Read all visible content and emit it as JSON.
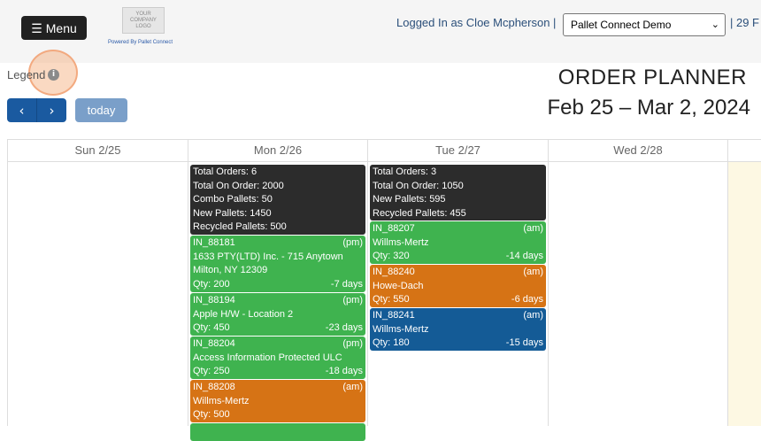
{
  "header": {
    "menu_label": "Menu",
    "logo_text": "YOUR COMPANY LOGO",
    "logo_caption": "Powered By Pallet Connect",
    "logged_in": "Logged In as Cloe Mcpherson  |",
    "account_select": "Pallet Connect Demo",
    "date_partial": "|  29 F"
  },
  "toolbar": {
    "legend_label": "Legend",
    "prev_icon": "chevron-left",
    "next_icon": "chevron-right",
    "today_label": "today"
  },
  "title": "ORDER PLANNER",
  "date_range": "Feb 25 – Mar 2, 2024",
  "columns": [
    {
      "label": "Sun 2/25"
    },
    {
      "label": "Mon 2/26"
    },
    {
      "label": "Tue 2/27"
    },
    {
      "label": "Wed 2/28"
    },
    {
      "label": ""
    }
  ],
  "mon": {
    "summary": [
      "Total Orders: 6",
      "Total On Order: 2000",
      "Combo Pallets: 50",
      "New Pallets: 1450",
      "Recycled Pallets: 500"
    ],
    "orders": [
      {
        "id": "IN_88181",
        "time": "(pm)",
        "line2": "1633 PTY(LTD) Inc. - 715 Anytown",
        "line3": "Milton, NY 12309",
        "qty": "Qty: 200",
        "days": "-7 days"
      },
      {
        "id": "IN_88194",
        "time": "(pm)",
        "line2": "Apple H/W - Location 2",
        "qty": "Qty: 450",
        "days": "-23 days"
      },
      {
        "id": "IN_88204",
        "time": "(pm)",
        "line2": "Access Information Protected ULC",
        "qty": "Qty: 250",
        "days": "-18 days"
      },
      {
        "id": "IN_88208",
        "time": "(am)",
        "line2": "Willms-Mertz",
        "qty": "Qty: 500",
        "days": ""
      }
    ]
  },
  "tue": {
    "summary": [
      "Total Orders: 3",
      "Total On Order: 1050",
      "New Pallets: 595",
      "Recycled Pallets: 455"
    ],
    "orders": [
      {
        "id": "IN_88207",
        "time": "(am)",
        "line2": "Willms-Mertz",
        "qty": "Qty: 320",
        "days": "-14 days"
      },
      {
        "id": "IN_88240",
        "time": "(am)",
        "line2": "Howe-Dach",
        "qty": "Qty: 550",
        "days": "-6 days"
      },
      {
        "id": "IN_88241",
        "time": "(am)",
        "line2": "Willms-Mertz",
        "qty": "Qty: 180",
        "days": "-15 days"
      }
    ]
  },
  "colors": {
    "summary": "#2c2c2c",
    "green": "#3fb34f",
    "orange": "#d67315",
    "blue": "#145b96",
    "today_bg": "#fdf8e3"
  }
}
